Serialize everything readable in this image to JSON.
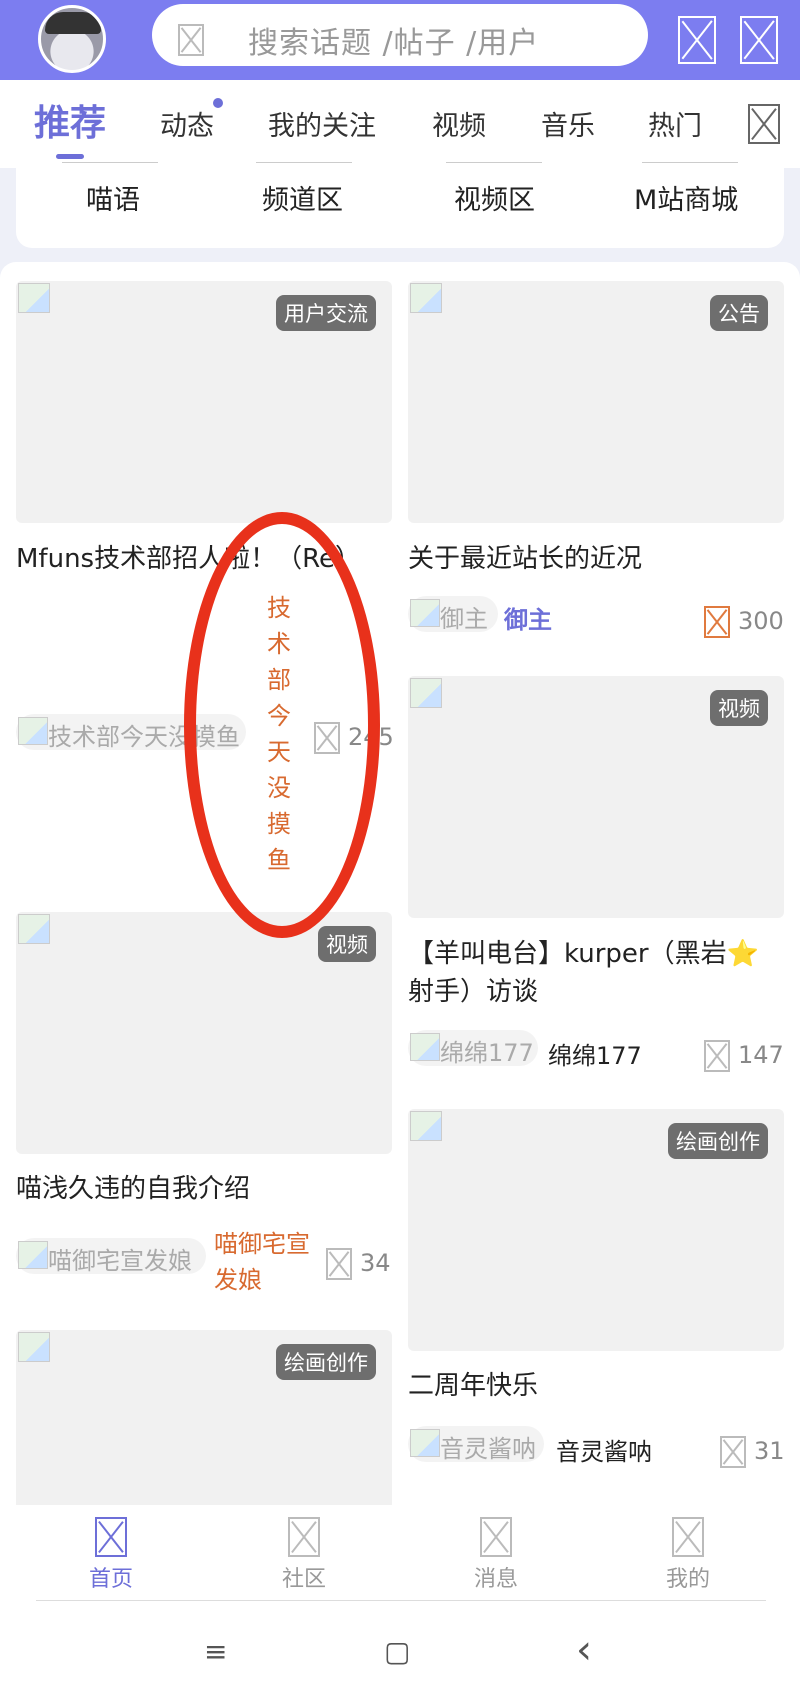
{
  "header": {
    "search_placeholder": "搜索话题 /帖子 /用户",
    "icons": [
      "avatar",
      "image-placeholder-icon",
      "scan-icon",
      "mail-icon"
    ]
  },
  "tabs": [
    {
      "label": "推荐",
      "active": true
    },
    {
      "label": "动态",
      "has_dot": true
    },
    {
      "label": "我的关注"
    },
    {
      "label": "视频"
    },
    {
      "label": "音乐"
    },
    {
      "label": "热门"
    }
  ],
  "subnav": [
    "喵语",
    "频道区",
    "视频区",
    "M站商城"
  ],
  "posts": [
    {
      "tag": "用户交流",
      "title": "Mfuns技术部招人啦！（Re）",
      "author_img_alt": "技术部今天没摸鱼",
      "author": "",
      "count": "245"
    },
    {
      "tag": "公告",
      "title": "关于最近站长的近况",
      "author_img_alt": "御主",
      "author": "御主",
      "count": "300"
    },
    {
      "tag": "视频",
      "title": "【羊叫电台】kurper（黑岩⭐射手）访谈",
      "author_img_alt": "绵绵177",
      "author": "绵绵177",
      "count": "147"
    },
    {
      "tag": "视频",
      "title": "喵浅久违的自我介绍",
      "author_img_alt": "喵御宅宣发娘",
      "author": "喵御宅宣\n发娘",
      "count": "34"
    },
    {
      "tag": "绘画创作",
      "title": "二周年快乐",
      "author_img_alt": "音灵酱呐",
      "author": "音灵酱呐",
      "count": "31"
    },
    {
      "tag": "绘画创作",
      "title": "",
      "author_img_alt": "",
      "author": "",
      "count": ""
    }
  ],
  "annotation": {
    "text": "技术部今天没摸鱼"
  },
  "bottom_nav": [
    {
      "label": "首页",
      "active": true
    },
    {
      "label": "社区"
    },
    {
      "label": "消息"
    },
    {
      "label": "我的"
    }
  ],
  "system_nav": {
    "menu": "≡",
    "home": "▢",
    "back": "‹"
  },
  "colors": {
    "accent": "#7c7df0",
    "accent_text": "#6d6fd8",
    "orange": "#d86a30",
    "annotation": "#e8311b"
  }
}
